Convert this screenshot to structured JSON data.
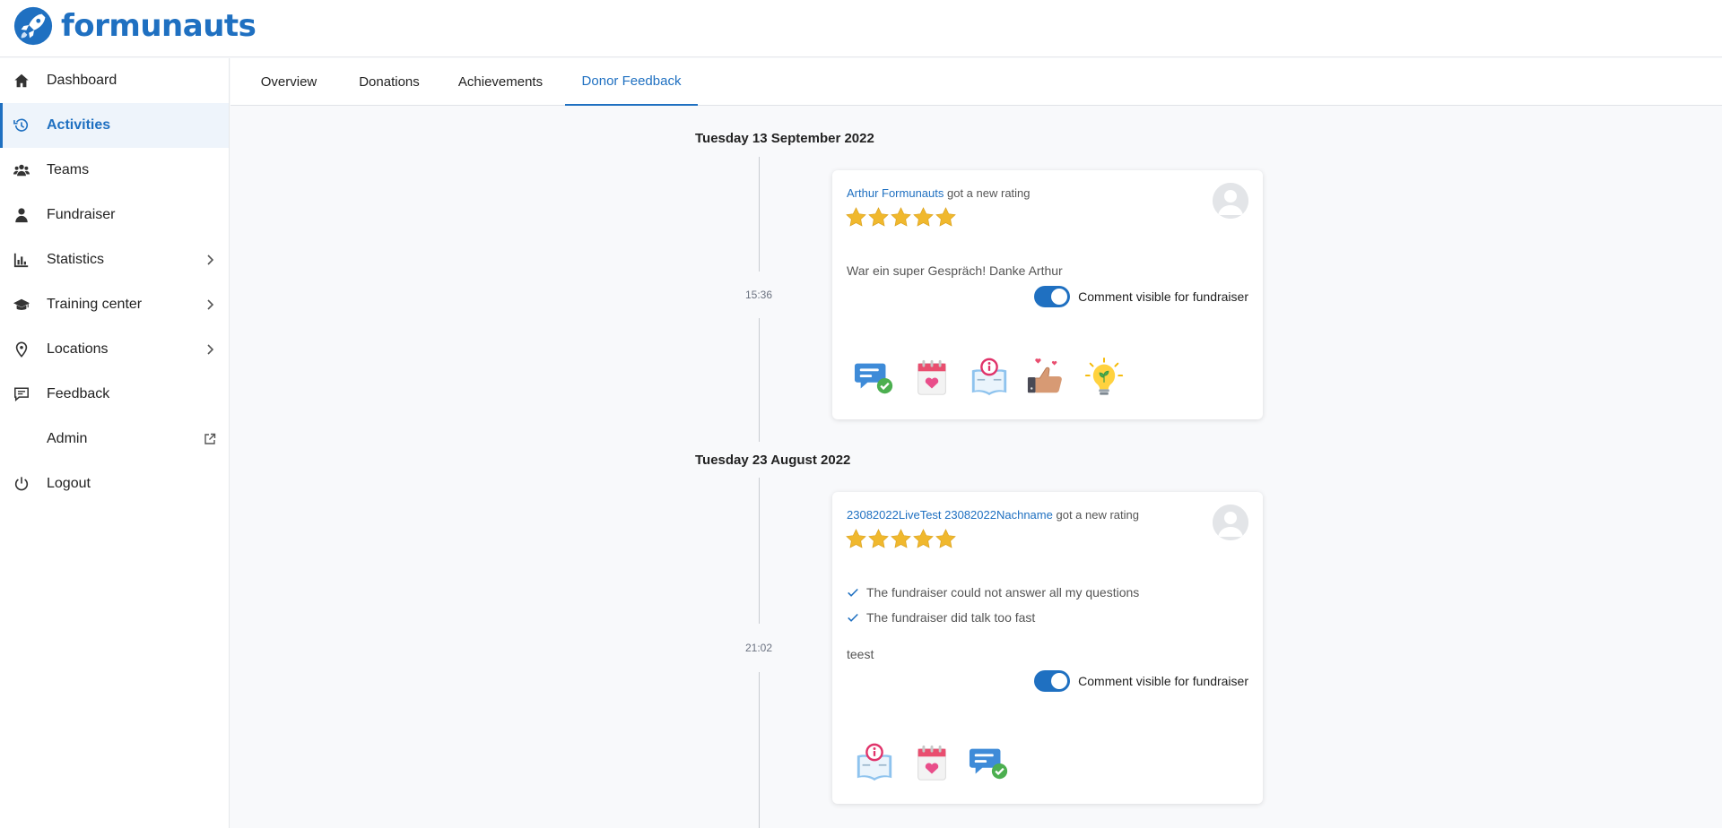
{
  "brand": {
    "name": "formunauts"
  },
  "sidebar": {
    "items": [
      {
        "label": "Dashboard",
        "icon": "home-icon"
      },
      {
        "label": "Activities",
        "icon": "history-icon",
        "active": true
      },
      {
        "label": "Teams",
        "icon": "users-icon"
      },
      {
        "label": "Fundraiser",
        "icon": "user-icon"
      },
      {
        "label": "Statistics",
        "icon": "bar-chart-icon",
        "expandable": true
      },
      {
        "label": "Training center",
        "icon": "graduation-cap-icon",
        "expandable": true
      },
      {
        "label": "Locations",
        "icon": "map-pin-icon",
        "expandable": true
      },
      {
        "label": "Feedback",
        "icon": "comment-icon"
      },
      {
        "label": "Admin",
        "icon": "",
        "external": true
      },
      {
        "label": "Logout",
        "icon": "power-icon"
      }
    ]
  },
  "tabs": [
    {
      "label": "Overview"
    },
    {
      "label": "Donations"
    },
    {
      "label": "Achievements"
    },
    {
      "label": "Donor Feedback",
      "active": true
    }
  ],
  "accent_color": "#1f70c1",
  "star_color": "#f0b82d",
  "feed": [
    {
      "date": "Tuesday 13 September 2022",
      "time": "15:36",
      "who": "Arthur Formunauts",
      "action": "got a new rating",
      "rating": 5,
      "reasons": [],
      "comment": "War ein super Gespräch! Danke Arthur",
      "toggle_label": "Comment visible for fundraiser",
      "toggle_on": true,
      "badges": [
        "chat-check-icon",
        "calendar-heart-icon",
        "info-book-icon",
        "thumbs-up-icon",
        "lightbulb-icon"
      ]
    },
    {
      "date": "Tuesday 23 August 2022",
      "time": "21:02",
      "who": "23082022LiveTest 23082022Nachname",
      "action": "got a new rating",
      "rating": 5,
      "reasons": [
        "The fundraiser could not answer all my questions",
        "The fundraiser did talk too fast"
      ],
      "comment": "teest",
      "toggle_label": "Comment visible for fundraiser",
      "toggle_on": true,
      "badges": [
        "info-book-icon",
        "calendar-heart-icon",
        "chat-check-icon"
      ]
    }
  ]
}
